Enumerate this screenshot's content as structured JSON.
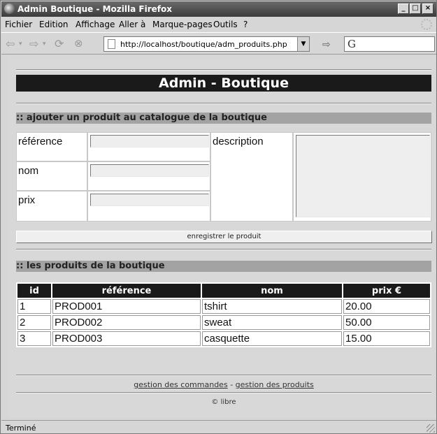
{
  "window": {
    "title": "Admin Boutique - Mozilla Firefox"
  },
  "menu": {
    "items": [
      "Fichier",
      "Edition",
      "Affichage",
      "Aller à",
      "Marque-pages",
      "Outils",
      "?"
    ]
  },
  "toolbar": {
    "url": "http://localhost/boutique/adm_produits.php",
    "back_icon": "back-arrow-icon",
    "forward_icon": "forward-arrow-icon",
    "reload_icon": "reload-icon",
    "stop_icon": "stop-icon",
    "search_engine_icon": "google-icon"
  },
  "page": {
    "header": "Admin - Boutique",
    "add_section_title": ":: ajouter un produit au catalogue de la boutique",
    "form": {
      "reference_label": "référence",
      "name_label": "nom",
      "price_label": "prix",
      "description_label": "description",
      "reference_value": "",
      "name_value": "",
      "price_value": "",
      "description_value": "",
      "save_label": "enregistrer le produit"
    },
    "list_section_title": ":: les produits de la boutique",
    "table": {
      "headers": [
        "id",
        "référence",
        "nom",
        "prix €"
      ],
      "rows": [
        [
          "1",
          "PROD001",
          "tshirt",
          "20.00"
        ],
        [
          "2",
          "PROD002",
          "sweat",
          "50.00"
        ],
        [
          "3",
          "PROD003",
          "casquette",
          "15.00"
        ]
      ]
    },
    "footer": {
      "orders_link": "gestion des commandes",
      "separator": "-",
      "products_link": "gestion des produits",
      "copyright": "© libre"
    }
  },
  "status": {
    "text": "Terminé"
  }
}
